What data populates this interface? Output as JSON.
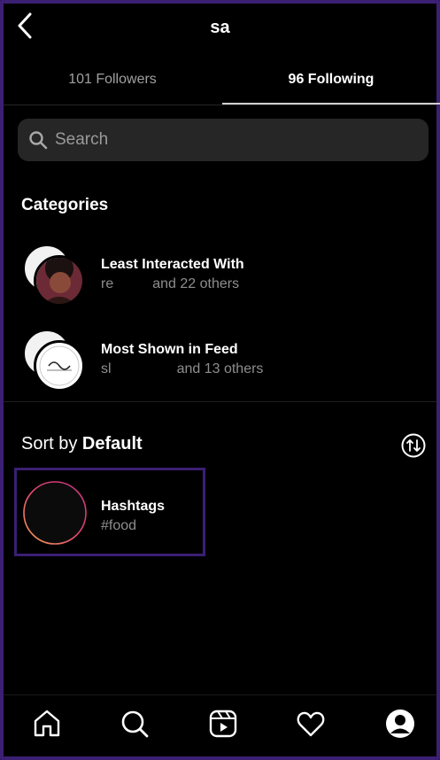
{
  "header": {
    "title": "sa",
    "back_icon": "chevron-left-icon"
  },
  "tabs": [
    {
      "label": "101 Followers",
      "active": false
    },
    {
      "label": "96 Following",
      "active": true
    }
  ],
  "search": {
    "placeholder": "Search",
    "value": ""
  },
  "categories": {
    "title": "Categories",
    "items": [
      {
        "label": "Least Interacted With",
        "sub_prefix": "re",
        "sub_suffix": "and 22 others"
      },
      {
        "label": "Most Shown in Feed",
        "sub_prefix": "sl",
        "sub_suffix": "and 13 others"
      }
    ]
  },
  "sort": {
    "prefix": "Sort by ",
    "value": "Default",
    "icon": "sort-arrows-icon"
  },
  "hashtags": {
    "label": "Hashtags",
    "sub": "#food"
  },
  "nav": [
    "home-icon",
    "search-icon",
    "reels-icon",
    "heart-icon",
    "profile-icon"
  ],
  "colors": {
    "accent_border": "#3b1f73",
    "background": "#000000",
    "search_bg": "#262626"
  }
}
